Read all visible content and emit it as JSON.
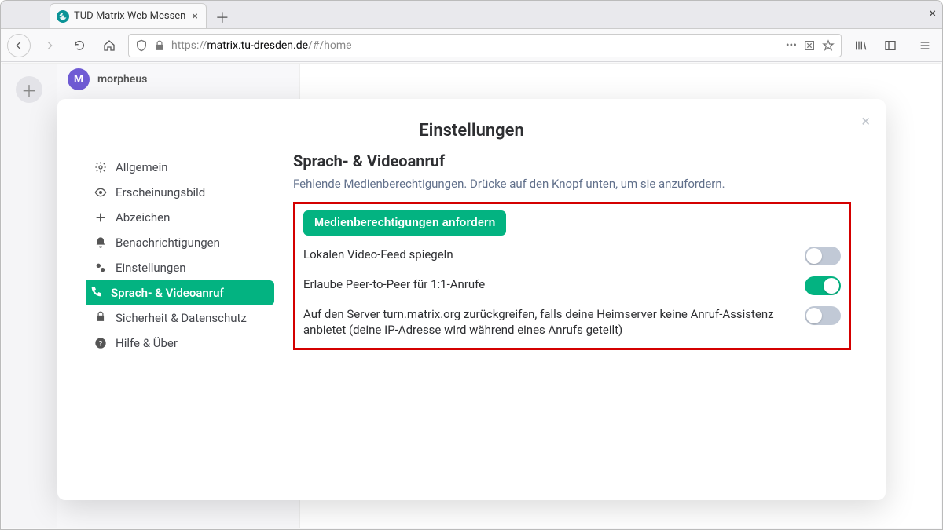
{
  "browser": {
    "tab_title": "TUD Matrix Web Messen",
    "url_prefix": "https://",
    "url_host": "matrix.tu-dresden.de",
    "url_path": "/#/home"
  },
  "app": {
    "username": "morpheus",
    "avatar_letter": "M"
  },
  "modal": {
    "title": "Einstellungen",
    "close_label": "×"
  },
  "nav": {
    "general": "Allgemein",
    "appearance": "Erscheinungsbild",
    "flair": "Abzeichen",
    "notifications": "Benachrichtigungen",
    "preferences": "Einstellungen",
    "voice": "Sprach- & Videoanruf",
    "security": "Sicherheit & Datenschutz",
    "help": "Hilfe & Über"
  },
  "voice_section": {
    "heading": "Sprach- & Videoanruf",
    "description": "Fehlende Medienberechtigungen. Drücke auf den Knopf unten, um sie anzufordern.",
    "request_button": "Medienberechtigungen anfordern",
    "settings": [
      {
        "label": "Lokalen Video-Feed spiegeln",
        "enabled": false
      },
      {
        "label": "Erlaube Peer-to-Peer für 1:1-Anrufe",
        "enabled": true
      },
      {
        "label": "Auf den Server turn.matrix.org zurückgreifen, falls deine Heimserver keine Anruf-Assistenz anbietet (deine IP-Adresse wird während eines Anrufs geteilt)",
        "enabled": false
      }
    ]
  }
}
